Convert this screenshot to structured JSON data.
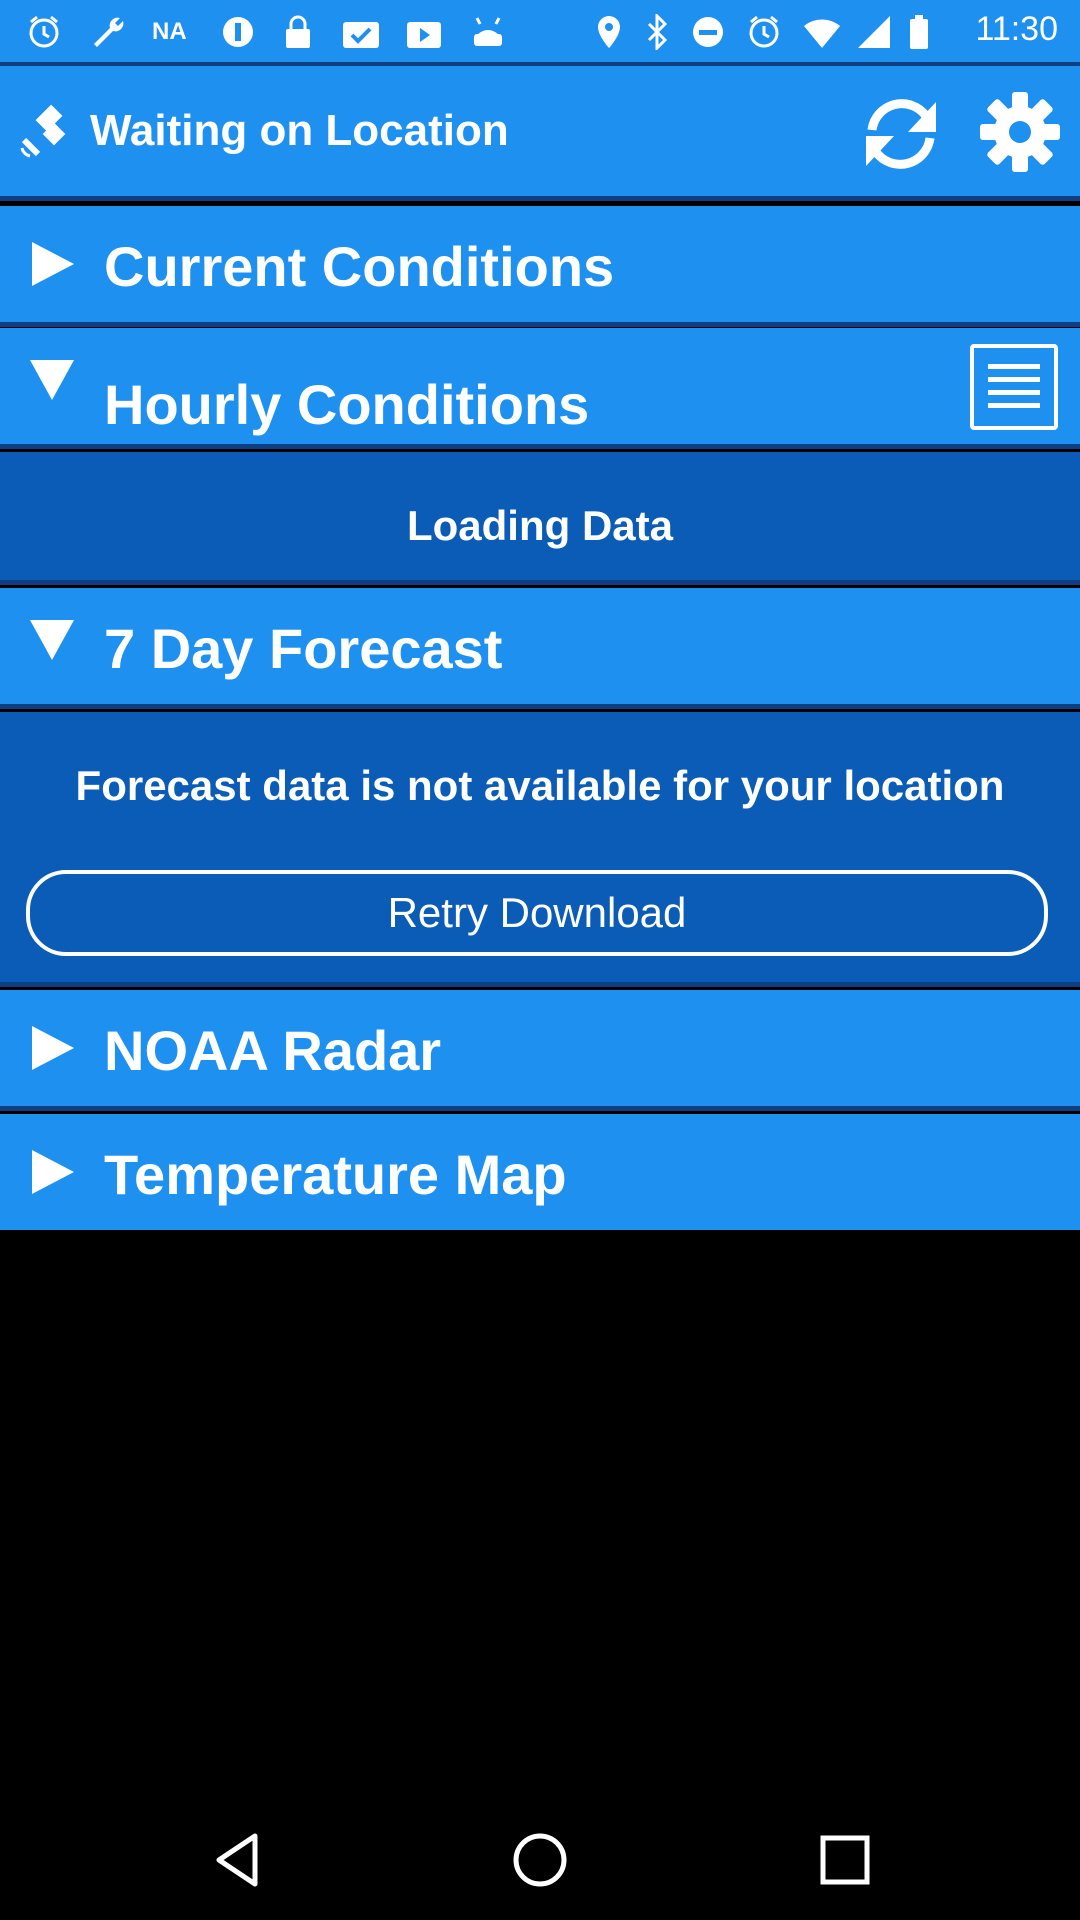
{
  "status_bar": {
    "time": "11:30",
    "na_label": "NA",
    "icons": [
      "alarm-icon",
      "wrench-icon",
      "na-icon",
      "info-icon",
      "lock-icon",
      "clipboard-check-icon",
      "media-icon",
      "android-icon",
      "location-icon",
      "bluetooth-icon",
      "dnd-icon",
      "alarm-icon",
      "wifi-icon",
      "signal-icon",
      "battery-icon"
    ]
  },
  "header": {
    "title": "Waiting on Location",
    "icons": {
      "left": "satellite-icon",
      "refresh": "refresh-icon",
      "settings": "gear-icon"
    }
  },
  "sections": {
    "current": {
      "title": "Current Conditions"
    },
    "hourly": {
      "title": "Hourly Conditions"
    },
    "loading": {
      "text": "Loading Data"
    },
    "seven_day": {
      "title": "7 Day Forecast"
    },
    "forecast_msg": {
      "text": "Forecast data is not available for your location",
      "retry_label": "Retry Download"
    },
    "noaa": {
      "title": "NOAA Radar"
    },
    "temp": {
      "title": "Temperature Map"
    }
  },
  "colors": {
    "bar": "#1e90f0",
    "panel": "#0b5cb7",
    "divider": "#0d3f82"
  },
  "nav_bar": {
    "icons": [
      "back-icon",
      "home-icon",
      "recents-icon"
    ]
  }
}
